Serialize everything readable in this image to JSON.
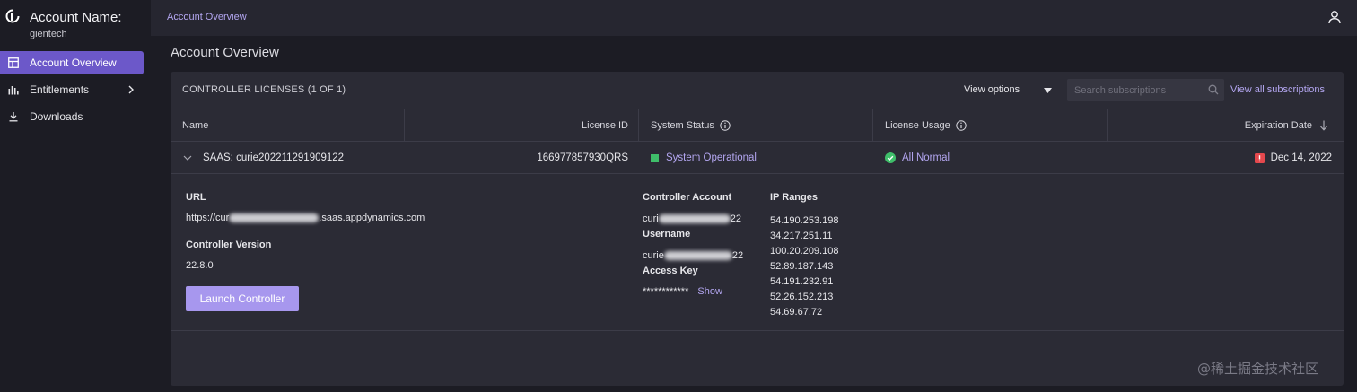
{
  "brand": {
    "title": "Account Name:",
    "subtitle": "gientech"
  },
  "sidebar": {
    "items": [
      {
        "label": "Account Overview",
        "icon": "dashboard-icon",
        "active": true
      },
      {
        "label": "Entitlements",
        "icon": "bar-chart-icon",
        "has_chevron": true
      },
      {
        "label": "Downloads",
        "icon": "download-icon"
      }
    ]
  },
  "topbar": {
    "breadcrumb": "Account Overview",
    "user_icon": "user-icon"
  },
  "page": {
    "title": "Account Overview"
  },
  "licenses": {
    "header": "CONTROLLER LICENSES (1 OF 1)",
    "view_options": "View options",
    "search_placeholder": "Search subscriptions",
    "view_all": "View all subscriptions",
    "columns": [
      "Name",
      "License ID",
      "System Status",
      "License Usage",
      "Expiration Date"
    ],
    "row": {
      "name": "SAAS: curie202211291909122",
      "license_id": "166977857930QRS",
      "system_status": "System Operational",
      "license_usage": "All Normal",
      "expiration": "Dec 14, 2022"
    },
    "detail": {
      "url_label": "URL",
      "url_prefix": "https://cur",
      "url_suffix": ".saas.appdynamics.com",
      "version_label": "Controller Version",
      "version_value": "22.8.0",
      "launch_button": "Launch Controller",
      "controller_account_label": "Controller Account",
      "controller_account_prefix": "curi",
      "controller_account_suffix": "22",
      "username_label": "Username",
      "username_prefix": "curie",
      "username_suffix": "22",
      "access_key_label": "Access Key",
      "access_key_value": "************",
      "show_link": "Show",
      "ip_ranges_label": "IP Ranges",
      "ip_ranges": [
        "54.190.253.198",
        "34.217.251.11",
        "100.20.209.108",
        "52.89.187.143",
        "54.191.232.91",
        "52.26.152.213",
        "54.69.67.72"
      ]
    }
  },
  "colors": {
    "accent": "#6c58c9",
    "link": "#b3a6f0",
    "button": "#a797ee",
    "success": "#3fbe6a",
    "danger": "#e5484d"
  },
  "watermark": "@稀土掘金技术社区"
}
